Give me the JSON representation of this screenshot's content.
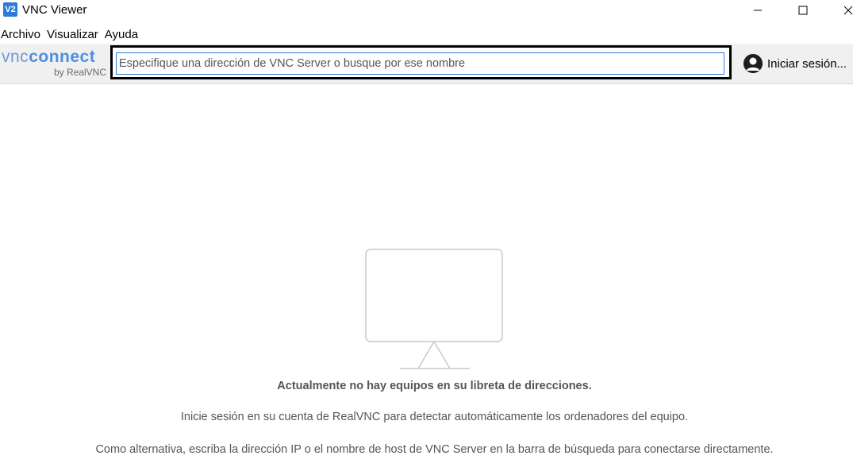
{
  "window": {
    "title": "VNC Viewer",
    "icon_name": "vnc-app-icon",
    "icon_text": "V2",
    "controls": [
      "minimize-icon",
      "maximize-icon",
      "close-icon"
    ]
  },
  "menu": {
    "items": [
      {
        "label": "Archivo"
      },
      {
        "label": "Visualizar"
      },
      {
        "label": "Ayuda"
      }
    ]
  },
  "toolbar": {
    "logo_main_vnc": "vnc",
    "logo_main_connect": "connect",
    "logo_sub": "by RealVNC",
    "search": {
      "value": "",
      "placeholder": "Especifique una dirección de VNC Server o busque por ese nombre"
    },
    "signin_label": "Iniciar sesión..."
  },
  "empty_state": {
    "icon_name": "monitor-icon",
    "title": "Actualmente no hay equipos en su libreta de direcciones.",
    "line1": "Inicie sesión en su cuenta de RealVNC para detectar automáticamente los ordenadores del equipo.",
    "line2": "Como alternativa, escriba la dirección IP o el nombre de host de VNC Server en la barra de búsqueda para conectarse directamente."
  },
  "colors": {
    "accent": "#2b7bd6",
    "toolbar_bg": "#f0f0f0",
    "text_muted": "#555555"
  }
}
